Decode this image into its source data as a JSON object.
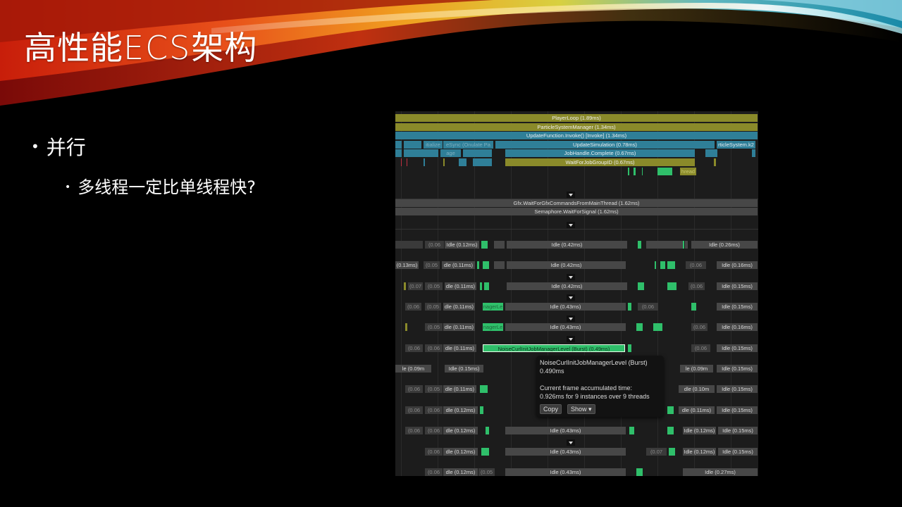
{
  "slide": {
    "title_cjk_1": "高性能",
    "title_latin": "ECS",
    "title_cjk_2": "架构",
    "bullet_1": "并行",
    "bullet_2": "多线程一定比单线程快?"
  },
  "colors": {
    "accent_green": "#2fbf6a",
    "marker_blue": "#2f7f98",
    "marker_olive": "#8a8a2a"
  },
  "profiler": {
    "main": {
      "player_loop": "PlayerLoop (1.89ms)",
      "particle_manager": "ParticleSystemManager (1.34ms)",
      "update_function": "UpdateFunction.Invoke() [Invoke] (1.34ms)",
      "initialize": "itialize",
      "sync": "eSync (Onulate Pa",
      "update_simulation": "UpdateSimulation (0.78ms)",
      "particle_system": "rticleSystem.k2",
      "age": "age",
      "job_complete": "JobHandle.Complete (0.67ms)",
      "wait_job": "WaitForJobGroupID (0.67ms)",
      "thread": "hread"
    },
    "render": {
      "gfx_wait": "Gfx.WaitForGfxCommandsFromMainThread (1.62ms)",
      "semaphore": "Semaphore.WaitForSignal (1.62ms)"
    },
    "workers": [
      {
        "a": "(0.06",
        "b": "Idle (0.12ms)",
        "c": "Idle (0.42ms)",
        "d": "Idle (0.26ms)"
      },
      {
        "a": "(0.13ms)",
        "a2": "(0.05",
        "b": "dle (0.11ms)",
        "c": "Idle (0.42ms)",
        "c2": "(0.06",
        "d": "Idle (0.16ms)"
      },
      {
        "a": "(0.07",
        "a2": "(0.05",
        "b": "dle (0.11ms)",
        "c": "Idle (0.42ms)",
        "c2": "(0.06",
        "d": "Idle (0.15ms)"
      },
      {
        "a": "(0.06",
        "a2": "(0.05",
        "b": "dle (0.11ms)",
        "b2": "nagerLe",
        "c": "Idle (0.43ms)",
        "c2": "(0.06",
        "d": "Idle (0.15ms)"
      },
      {
        "a": "(0.05",
        "b": "dle (0.11ms)",
        "b2": "nagerLe",
        "c": "Idle (0.43ms)",
        "c2": "(0.06",
        "d": "Idle (0.16ms)"
      },
      {
        "a": "(0.06",
        "a2": "(0.06",
        "b": "dle (0.11ms)",
        "green": "NoiseCurlInitJobManagerLevel (Burst) (0.49ms)",
        "c2": "(0.06",
        "d": "Idle (0.15ms)"
      },
      {
        "a": "le (0.09m",
        "b": "Idle (0.15ms)",
        "c2": "le (0.09m",
        "d": "Idle (0.15ms)"
      },
      {
        "a": "(0.06",
        "a2": "(0.05",
        "b": "dle (0.11ms)",
        "c2": "dle (0.10m",
        "d": "Idle (0.15ms)"
      },
      {
        "a": "(0.06",
        "a2": "(0.06",
        "b": "dle (0.12ms)",
        "c2": "dle (0.11ms)",
        "d": "Idle (0.15ms)"
      },
      {
        "a": "(0.06",
        "a2": "(0.06",
        "b": "dle (0.12ms)",
        "c": "Idle (0.43ms)",
        "c2": "Idle (0.12ms)",
        "d": "Idle (0.15ms)"
      },
      {
        "a": "(0.06",
        "b": "dle (0.12ms)",
        "c": "Idle (0.43ms)",
        "c2": "(0.07",
        "c3": "Idle (0.12ms)",
        "d": "Idle (0.15ms)"
      },
      {
        "a": "(0.06",
        "b": "dle (0.12ms)",
        "a2": "(0.05",
        "c": "Idle (0.43ms)",
        "d": "Idle (0.27ms)"
      }
    ],
    "tooltip": {
      "name": "NoiseCurlInitJobManagerLevel (Burst)",
      "duration": "0.490ms",
      "accum_label": "Current frame accumulated time:",
      "accum_value": "0.926ms for 9 instances over 9 threads",
      "copy": "Copy",
      "show": "Show ▾"
    }
  }
}
